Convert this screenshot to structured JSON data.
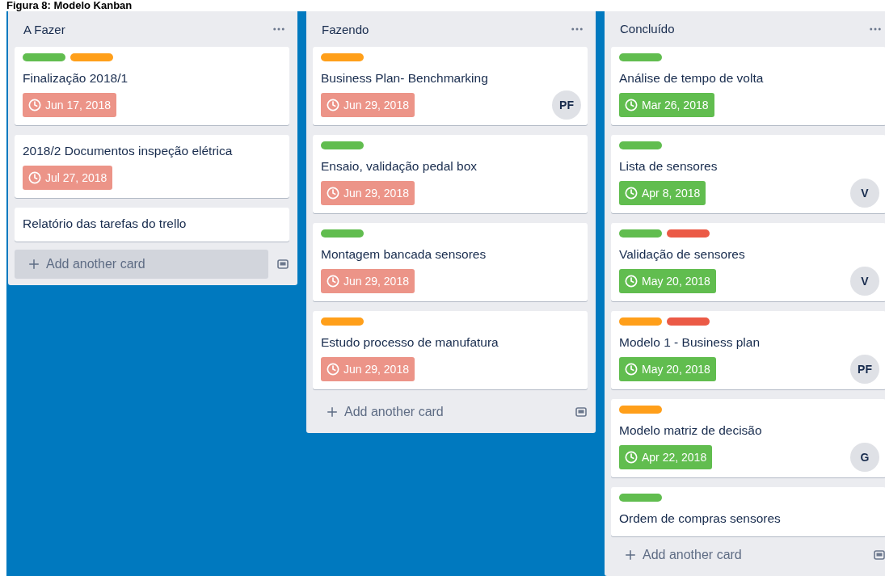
{
  "caption": "Figura 8: Modelo Kanban",
  "columns": [
    {
      "title": "A Fazer",
      "add_label": "Add another card",
      "add_highlighted": true,
      "cards": [
        {
          "labels": [
            {
              "color": "#61bd4f"
            },
            {
              "color": "#ff9f1a"
            }
          ],
          "title": "Finalização 2018/1",
          "due": {
            "date": "Jun 17, 2018",
            "complete": false
          }
        },
        {
          "title": "2018/2 Documentos inspeção elétrica",
          "due": {
            "date": "Jul 27, 2018",
            "complete": false
          }
        },
        {
          "title": "Relatório das tarefas do trello"
        }
      ]
    },
    {
      "title": "Fazendo",
      "add_label": "Add another card",
      "add_highlighted": false,
      "cards": [
        {
          "labels": [
            {
              "color": "#ff9f1a"
            }
          ],
          "title": "Business Plan- Benchmarking",
          "due": {
            "date": "Jun 29, 2018",
            "complete": false
          },
          "member": "PF"
        },
        {
          "labels": [
            {
              "color": "#61bd4f"
            }
          ],
          "title": "Ensaio, validação pedal box",
          "due": {
            "date": "Jun 29, 2018",
            "complete": false
          }
        },
        {
          "labels": [
            {
              "color": "#61bd4f"
            }
          ],
          "title": "Montagem bancada sensores",
          "due": {
            "date": "Jun 29, 2018",
            "complete": false
          }
        },
        {
          "labels": [
            {
              "color": "#ff9f1a"
            }
          ],
          "title": "Estudo processo de manufatura",
          "due": {
            "date": "Jun 29, 2018",
            "complete": false
          }
        }
      ]
    },
    {
      "title": "Concluído",
      "add_label": "Add another card",
      "add_highlighted": false,
      "cards": [
        {
          "labels": [
            {
              "color": "#61bd4f"
            }
          ],
          "title": "Análise de tempo de volta",
          "due": {
            "date": "Mar 26, 2018",
            "complete": true
          }
        },
        {
          "labels": [
            {
              "color": "#61bd4f"
            }
          ],
          "title": "Lista de sensores",
          "due": {
            "date": "Apr 8, 2018",
            "complete": true
          },
          "member": "V"
        },
        {
          "labels": [
            {
              "color": "#61bd4f"
            },
            {
              "color": "#eb5a46"
            }
          ],
          "title": "Validação de sensores",
          "due": {
            "date": "May 20, 2018",
            "complete": true
          },
          "member": "V"
        },
        {
          "labels": [
            {
              "color": "#ff9f1a"
            },
            {
              "color": "#eb5a46"
            }
          ],
          "title": "Modelo 1 - Business plan",
          "due": {
            "date": "May 20, 2018",
            "complete": true
          },
          "member": "PF"
        },
        {
          "labels": [
            {
              "color": "#ff9f1a"
            }
          ],
          "title": "Modelo matriz de decisão",
          "due": {
            "date": "Apr 22, 2018",
            "complete": true
          },
          "member": "G"
        },
        {
          "labels": [
            {
              "color": "#61bd4f"
            }
          ],
          "title": "Ordem de compras sensores"
        }
      ]
    }
  ]
}
